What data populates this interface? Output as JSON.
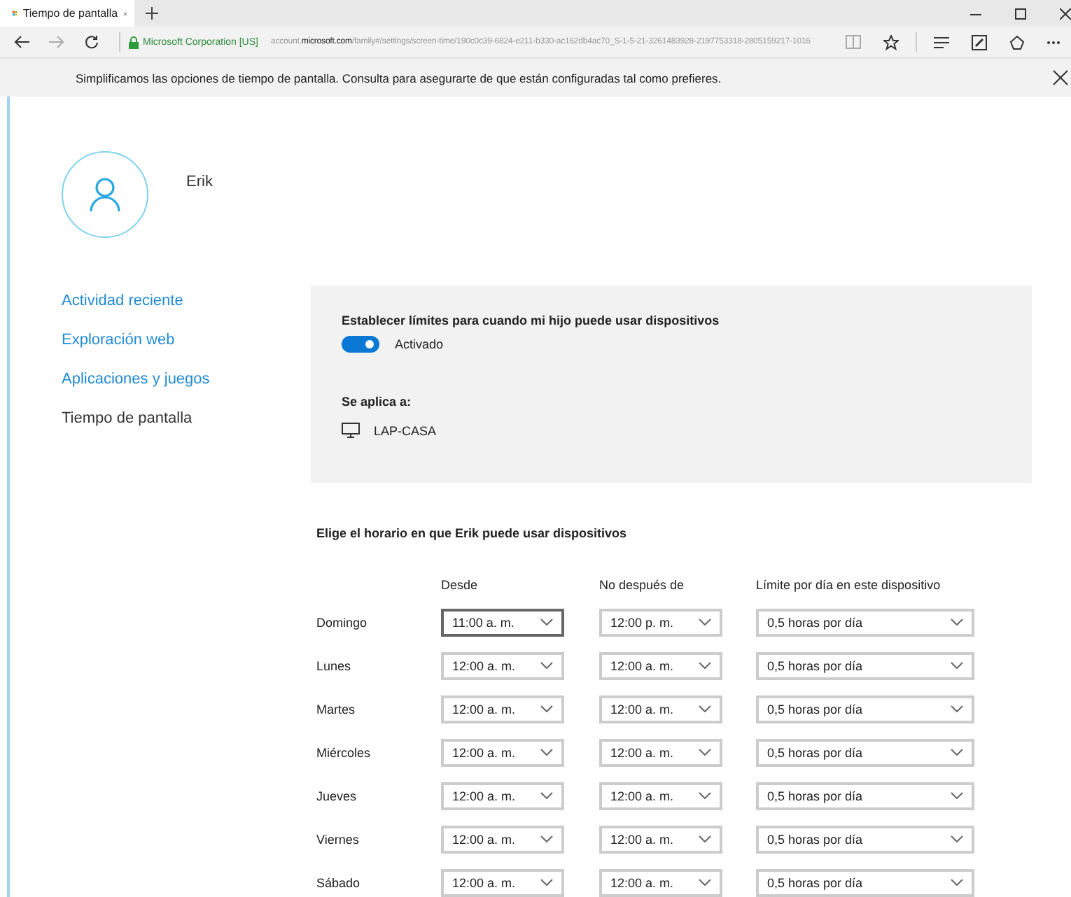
{
  "browser": {
    "tab_title": "Tiempo de pantalla",
    "site_identity": "Microsoft Corporation [US]",
    "url_prefix": "account.",
    "url_domain": "microsoft.com",
    "url_path": "/family#/settings/screen-time/190c0c39-6824-e211-b330-ac162db4ac70_S-1-5-21-3261483928-2197753318-2805159217-1016"
  },
  "notice": {
    "text": "Simplificamos las opciones de tiempo de pantalla. Consulta para asegurarte de que están configuradas tal como prefieres."
  },
  "profile": {
    "name": "Erik"
  },
  "sidebar": {
    "items": [
      {
        "label": "Actividad reciente",
        "selected": false
      },
      {
        "label": "Exploración web",
        "selected": false
      },
      {
        "label": "Aplicaciones y juegos",
        "selected": false
      },
      {
        "label": "Tiempo de pantalla",
        "selected": true
      }
    ]
  },
  "limits_panel": {
    "title": "Establecer límites para cuando mi hijo puede usar dispositivos",
    "toggle": {
      "on": true,
      "label": "Activado"
    },
    "applies_label": "Se aplica a:",
    "device": "LAP-CASA"
  },
  "schedule": {
    "title": "Elige el horario en que Erik puede usar dispositivos",
    "columns": [
      "Desde",
      "No después de",
      "Límite por día en este dispositivo"
    ],
    "rows": [
      {
        "day": "Domingo",
        "from": "11:00 a. m.",
        "from_focused": true,
        "until": "12:00 p. m.",
        "limit": "0,5 horas por día"
      },
      {
        "day": "Lunes",
        "from": "12:00 a. m.",
        "from_focused": false,
        "until": "12:00 a. m.",
        "limit": "0,5 horas por día"
      },
      {
        "day": "Martes",
        "from": "12:00 a. m.",
        "from_focused": false,
        "until": "12:00 a. m.",
        "limit": "0,5 horas por día"
      },
      {
        "day": "Miércoles",
        "from": "12:00 a. m.",
        "from_focused": false,
        "until": "12:00 a. m.",
        "limit": "0,5 horas por día"
      },
      {
        "day": "Jueves",
        "from": "12:00 a. m.",
        "from_focused": false,
        "until": "12:00 a. m.",
        "limit": "0,5 horas por día"
      },
      {
        "day": "Viernes",
        "from": "12:00 a. m.",
        "from_focused": false,
        "until": "12:00 a. m.",
        "limit": "0,5 horas por día"
      },
      {
        "day": "Sábado",
        "from": "12:00 a. m.",
        "from_focused": false,
        "until": "12:00 a. m.",
        "limit": "0,5 horas por día"
      }
    ]
  }
}
